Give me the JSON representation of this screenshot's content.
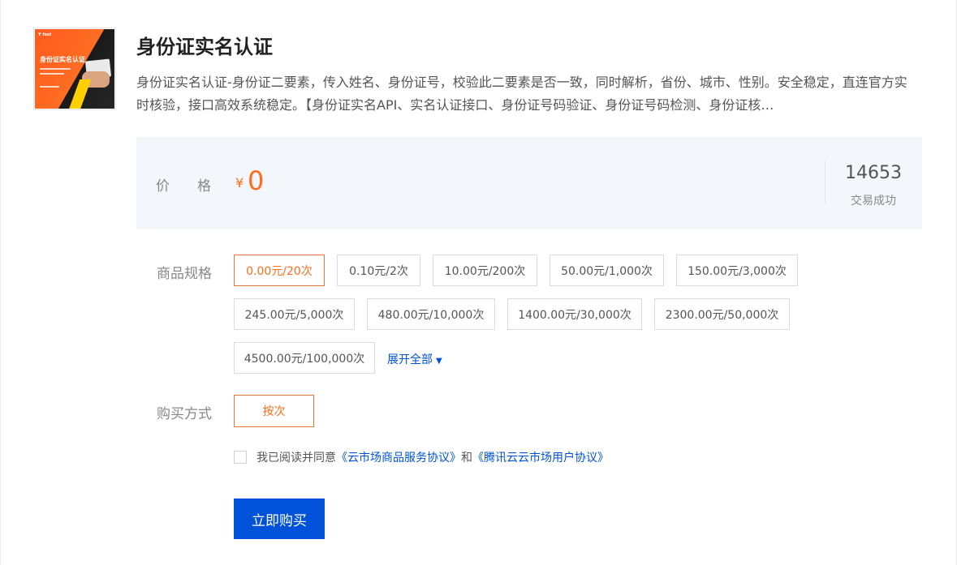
{
  "product": {
    "title": "身份证实名认证",
    "description": "身份证实名认证-身份证二要素，传入姓名、身份证号，校验此二要素是否一致，同时解析，省份、城市、性别。安全稳定，直连官方实时核验，接口高效系统稳定。【身份证实名API、实名认证接口、身份证号码验证、身份证号码检测、身份证核…",
    "thumbnail": {
      "logo": "Y fast",
      "heading": "身份证实名认证"
    }
  },
  "price": {
    "label": "价格",
    "currency": "¥",
    "value": "0",
    "sales_count": "14653",
    "sales_label": "交易成功"
  },
  "specs": {
    "label": "商品规格",
    "options": [
      "0.00元/20次",
      "0.10元/2次",
      "10.00元/200次",
      "50.00元/1,000次",
      "150.00元/3,000次",
      "245.00元/5,000次",
      "480.00元/10,000次",
      "1400.00元/30,000次",
      "2300.00元/50,000次",
      "4500.00元/100,000次"
    ],
    "selected_index": 0,
    "expand_label": "展开全部",
    "expand_arrow": "▼"
  },
  "purchase_method": {
    "label": "购买方式",
    "option": "按次"
  },
  "agreement": {
    "checked": false,
    "prefix": "我已阅读并同意",
    "link1": "《云市场商品服务协议》",
    "conjunction": "和",
    "link2": "《腾讯云云市场用户协议》"
  },
  "buy_button": "立即购买",
  "colors": {
    "accent_orange": "#ff6d1a",
    "primary_blue": "#0052d9",
    "panel_bg": "#f3f6fa"
  }
}
